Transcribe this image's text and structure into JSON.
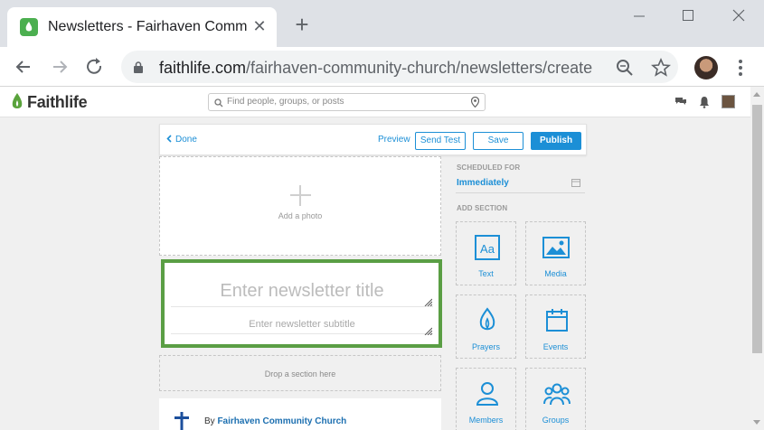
{
  "browser": {
    "tab_title": "Newsletters - Fairhaven Community Church",
    "url_domain": "faithlife.com",
    "url_path": "/fairhaven-community-church/newsletters/create"
  },
  "app": {
    "logo_text": "Faithlife",
    "search_placeholder": "Find people, groups, or posts"
  },
  "editor": {
    "done_label": "Done",
    "preview_label": "Preview",
    "send_test_label": "Send Test",
    "save_label": "Save",
    "publish_label": "Publish",
    "add_photo_label": "Add a photo",
    "title_placeholder": "Enter newsletter title",
    "subtitle_placeholder": "Enter newsletter subtitle",
    "drop_label": "Drop a section here",
    "byline_prefix": "By",
    "byline_church": "Fairhaven Community Church"
  },
  "sidebar": {
    "scheduled_label": "SCHEDULED FOR",
    "scheduled_value": "Immediately",
    "add_section_label": "ADD SECTION",
    "sections": [
      {
        "label": "Text",
        "icon": "text-icon"
      },
      {
        "label": "Media",
        "icon": "media-icon"
      },
      {
        "label": "Prayers",
        "icon": "prayers-icon"
      },
      {
        "label": "Events",
        "icon": "events-icon"
      },
      {
        "label": "Members",
        "icon": "members-icon"
      },
      {
        "label": "Groups",
        "icon": "groups-icon"
      }
    ]
  },
  "colors": {
    "accent": "#1c8fd6",
    "highlight_border": "#5a9e44"
  }
}
